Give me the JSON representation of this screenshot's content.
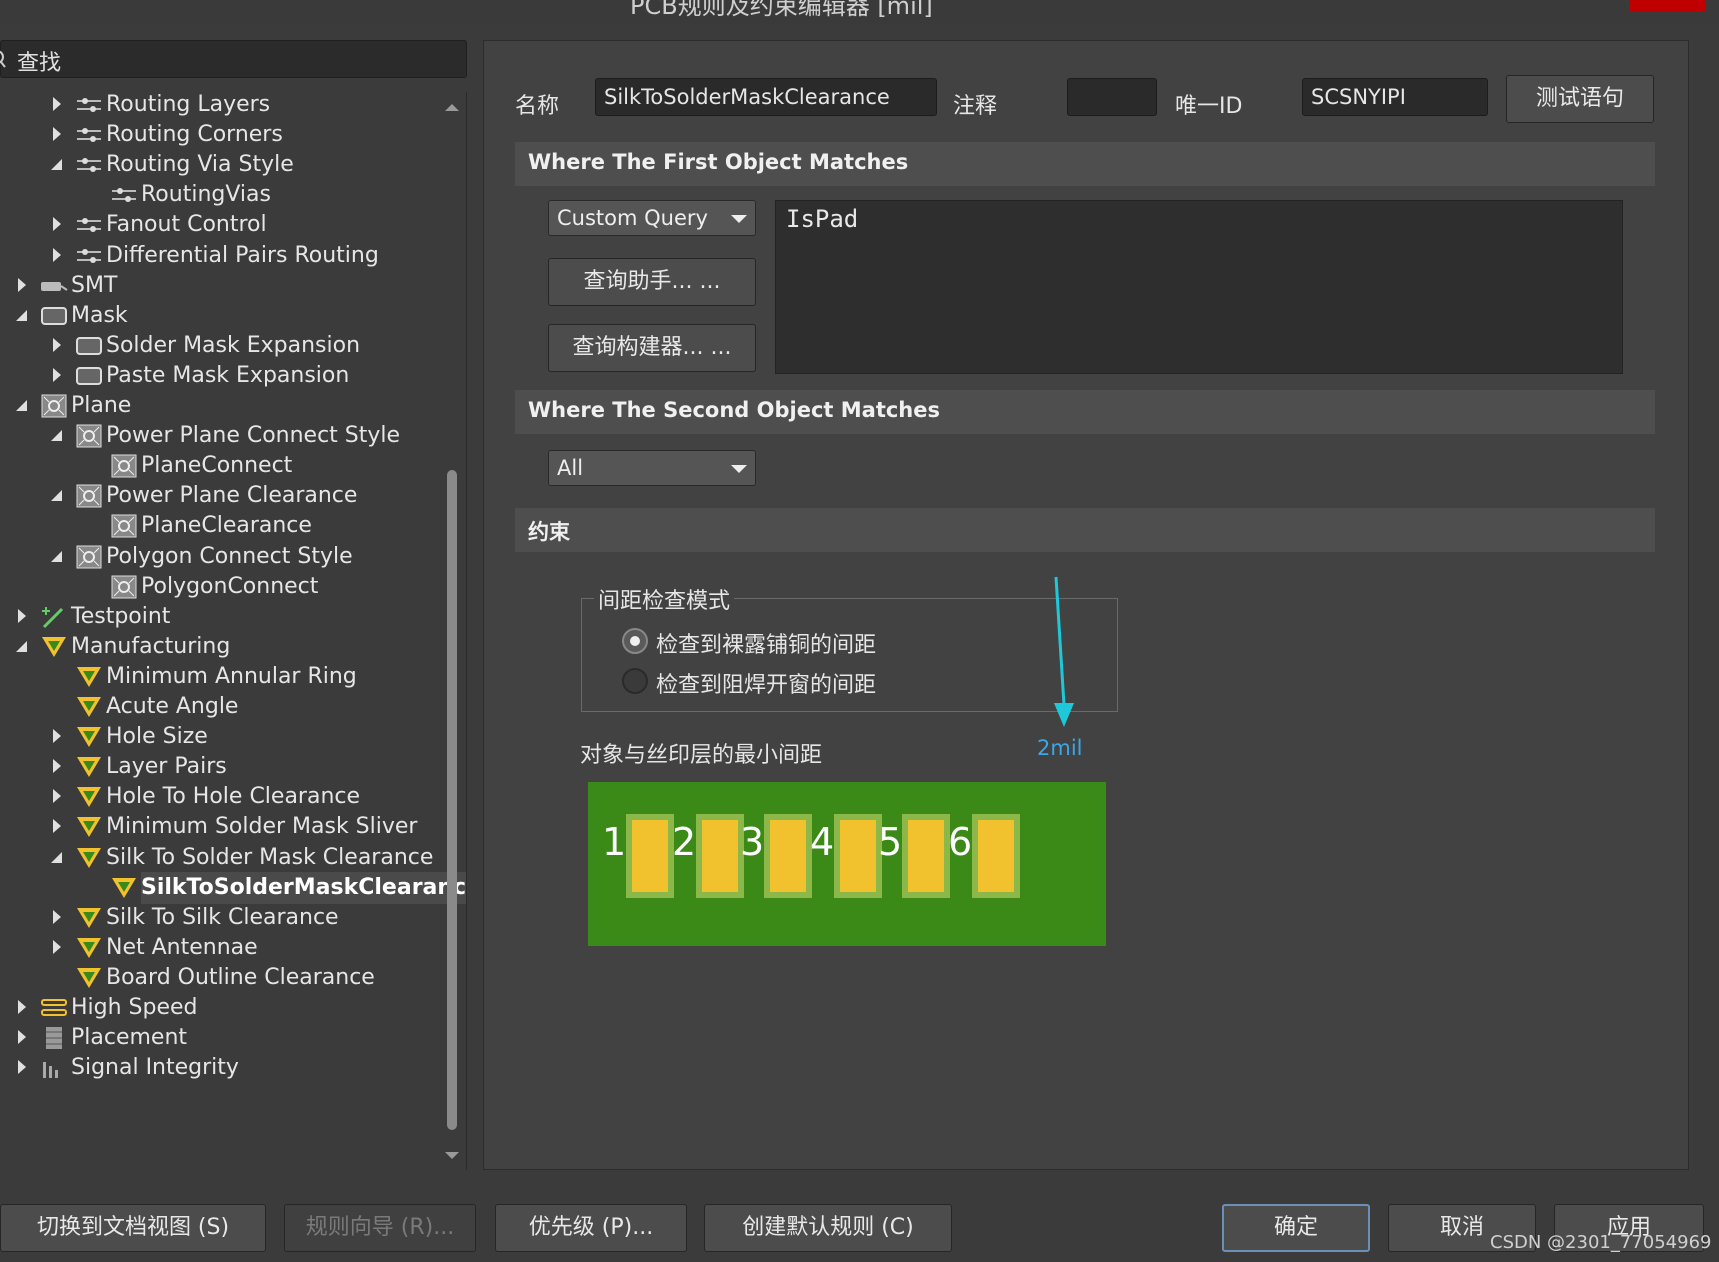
{
  "window": {
    "title": "PCB规则及约束编辑器 [mil]"
  },
  "search": {
    "label": "查找"
  },
  "tree": [
    {
      "label": "Routing Layers",
      "icon": "routing-icon",
      "state": "collapsed",
      "level": 2
    },
    {
      "label": "Routing Corners",
      "icon": "routing-icon",
      "state": "collapsed",
      "level": 2
    },
    {
      "label": "Routing Via Style",
      "icon": "routing-icon",
      "state": "expanded",
      "level": 2
    },
    {
      "label": "RoutingVias",
      "icon": "routing-icon",
      "state": "leaf",
      "level": 3
    },
    {
      "label": "Fanout Control",
      "icon": "routing-icon",
      "state": "collapsed",
      "level": 2
    },
    {
      "label": "Differential Pairs Routing",
      "icon": "routing-icon",
      "state": "collapsed",
      "level": 2
    },
    {
      "label": "SMT",
      "icon": "smt-icon",
      "state": "collapsed",
      "level": 1
    },
    {
      "label": "Mask",
      "icon": "mask-icon",
      "state": "expanded",
      "level": 1
    },
    {
      "label": "Solder Mask Expansion",
      "icon": "mask-icon",
      "state": "collapsed",
      "level": 2
    },
    {
      "label": "Paste Mask Expansion",
      "icon": "mask-icon",
      "state": "collapsed",
      "level": 2
    },
    {
      "label": "Plane",
      "icon": "plane-icon",
      "state": "expanded",
      "level": 1
    },
    {
      "label": "Power Plane Connect Style",
      "icon": "plane-icon",
      "state": "expanded",
      "level": 2
    },
    {
      "label": "PlaneConnect",
      "icon": "plane-icon",
      "state": "leaf",
      "level": 3
    },
    {
      "label": "Power Plane Clearance",
      "icon": "plane-icon",
      "state": "expanded",
      "level": 2
    },
    {
      "label": "PlaneClearance",
      "icon": "plane-icon",
      "state": "leaf",
      "level": 3
    },
    {
      "label": "Polygon Connect Style",
      "icon": "plane-icon",
      "state": "expanded",
      "level": 2
    },
    {
      "label": "PolygonConnect",
      "icon": "plane-icon",
      "state": "leaf",
      "level": 3
    },
    {
      "label": "Testpoint",
      "icon": "testpoint-icon",
      "state": "collapsed",
      "level": 1
    },
    {
      "label": "Manufacturing",
      "icon": "manufacturing-icon",
      "state": "expanded",
      "level": 1
    },
    {
      "label": "Minimum Annular Ring",
      "icon": "manufacturing-icon",
      "state": "leaf",
      "level": 2
    },
    {
      "label": "Acute Angle",
      "icon": "manufacturing-icon",
      "state": "leaf",
      "level": 2
    },
    {
      "label": "Hole Size",
      "icon": "manufacturing-icon",
      "state": "collapsed",
      "level": 2
    },
    {
      "label": "Layer Pairs",
      "icon": "manufacturing-icon",
      "state": "collapsed",
      "level": 2
    },
    {
      "label": "Hole To Hole Clearance",
      "icon": "manufacturing-icon",
      "state": "collapsed",
      "level": 2
    },
    {
      "label": "Minimum Solder Mask Sliver",
      "icon": "manufacturing-icon",
      "state": "collapsed",
      "level": 2
    },
    {
      "label": "Silk To Solder Mask Clearance",
      "icon": "manufacturing-icon",
      "state": "expanded",
      "level": 2
    },
    {
      "label": "SilkToSolderMaskClearance",
      "icon": "manufacturing-icon",
      "state": "leaf",
      "level": 3,
      "selected": true
    },
    {
      "label": "Silk To Silk Clearance",
      "icon": "manufacturing-icon",
      "state": "collapsed",
      "level": 2
    },
    {
      "label": "Net Antennae",
      "icon": "manufacturing-icon",
      "state": "collapsed",
      "level": 2
    },
    {
      "label": "Board Outline Clearance",
      "icon": "manufacturing-icon",
      "state": "leaf",
      "level": 2
    },
    {
      "label": "High Speed",
      "icon": "high-speed-icon",
      "state": "collapsed",
      "level": 1
    },
    {
      "label": "Placement",
      "icon": "placement-icon",
      "state": "collapsed",
      "level": 1
    },
    {
      "label": "Signal Integrity",
      "icon": "signal-integrity-icon",
      "state": "collapsed",
      "level": 1
    }
  ],
  "rule": {
    "name_label": "名称",
    "name_value": "SilkToSolderMaskClearance",
    "comment_label": "注释",
    "comment_value": "",
    "uid_label": "唯一ID",
    "uid_value": "SCSNYIPI",
    "test_button": "测试语句"
  },
  "first_object": {
    "heading": "Where The First Object Matches",
    "query_type": "Custom Query",
    "query_helper_button": "查询助手... ...",
    "query_builder_button": "查询构建器... ...",
    "query_text": "IsPad"
  },
  "second_object": {
    "heading": "Where The Second Object Matches",
    "query_type": "All"
  },
  "constraints": {
    "heading": "约束",
    "mode_group_label": "间距检查模式",
    "options": [
      {
        "label": "检查到裸露铺铜的间距",
        "checked": true
      },
      {
        "label": "检查到阻焊开窗的间距",
        "checked": false
      }
    ],
    "min_clearance_label": "对象与丝印层的最小间距",
    "min_clearance_value": "2mil",
    "pad_numbers": [
      "1",
      "2",
      "3",
      "4",
      "5",
      "6"
    ]
  },
  "footer": {
    "switch_view": "切换到文档视图 (S)",
    "rule_wizard": "规则向导 (R)...",
    "priority": "优先级 (P)...",
    "create_default": "创建默认规则 (C)",
    "ok": "确定",
    "cancel": "取消",
    "apply": "应用"
  },
  "watermark": "CSDN @2301_77054969",
  "colors": {
    "background": "#3b3b3b",
    "panel": "#424242",
    "pcb_green": "#3a8a1a",
    "pad_yellow": "#f2c12e",
    "arrow_cyan": "#1ec8d8"
  }
}
